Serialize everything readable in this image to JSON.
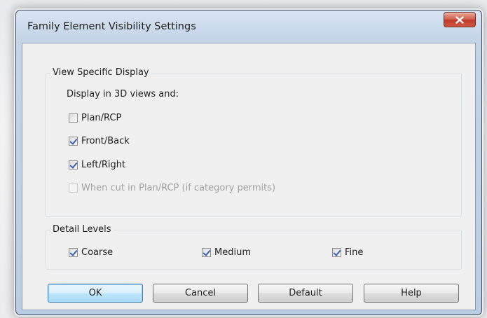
{
  "dialog": {
    "title": "Family Element Visibility Settings",
    "close_icon": "close-x-icon"
  },
  "view_specific": {
    "legend": "View Specific Display",
    "subheading": "Display in 3D views and:",
    "options": [
      {
        "label": "Plan/RCP",
        "checked": false,
        "enabled": true
      },
      {
        "label": "Front/Back",
        "checked": true,
        "enabled": true
      },
      {
        "label": "Left/Right",
        "checked": true,
        "enabled": true
      },
      {
        "label": "When cut in Plan/RCP (if category permits)",
        "checked": false,
        "enabled": false
      }
    ]
  },
  "detail_levels": {
    "legend": "Detail Levels",
    "options": [
      {
        "label": "Coarse",
        "checked": true
      },
      {
        "label": "Medium",
        "checked": true
      },
      {
        "label": "Fine",
        "checked": true
      }
    ]
  },
  "buttons": {
    "ok": "OK",
    "cancel": "Cancel",
    "default": "Default",
    "help": "Help"
  },
  "colors": {
    "titlebar": "#c4d5e8",
    "close_button": "#c0392b",
    "client_background": "#f0f0f0",
    "checkmark": "#3a5fb2",
    "default_button_border": "#3c7fb1"
  }
}
